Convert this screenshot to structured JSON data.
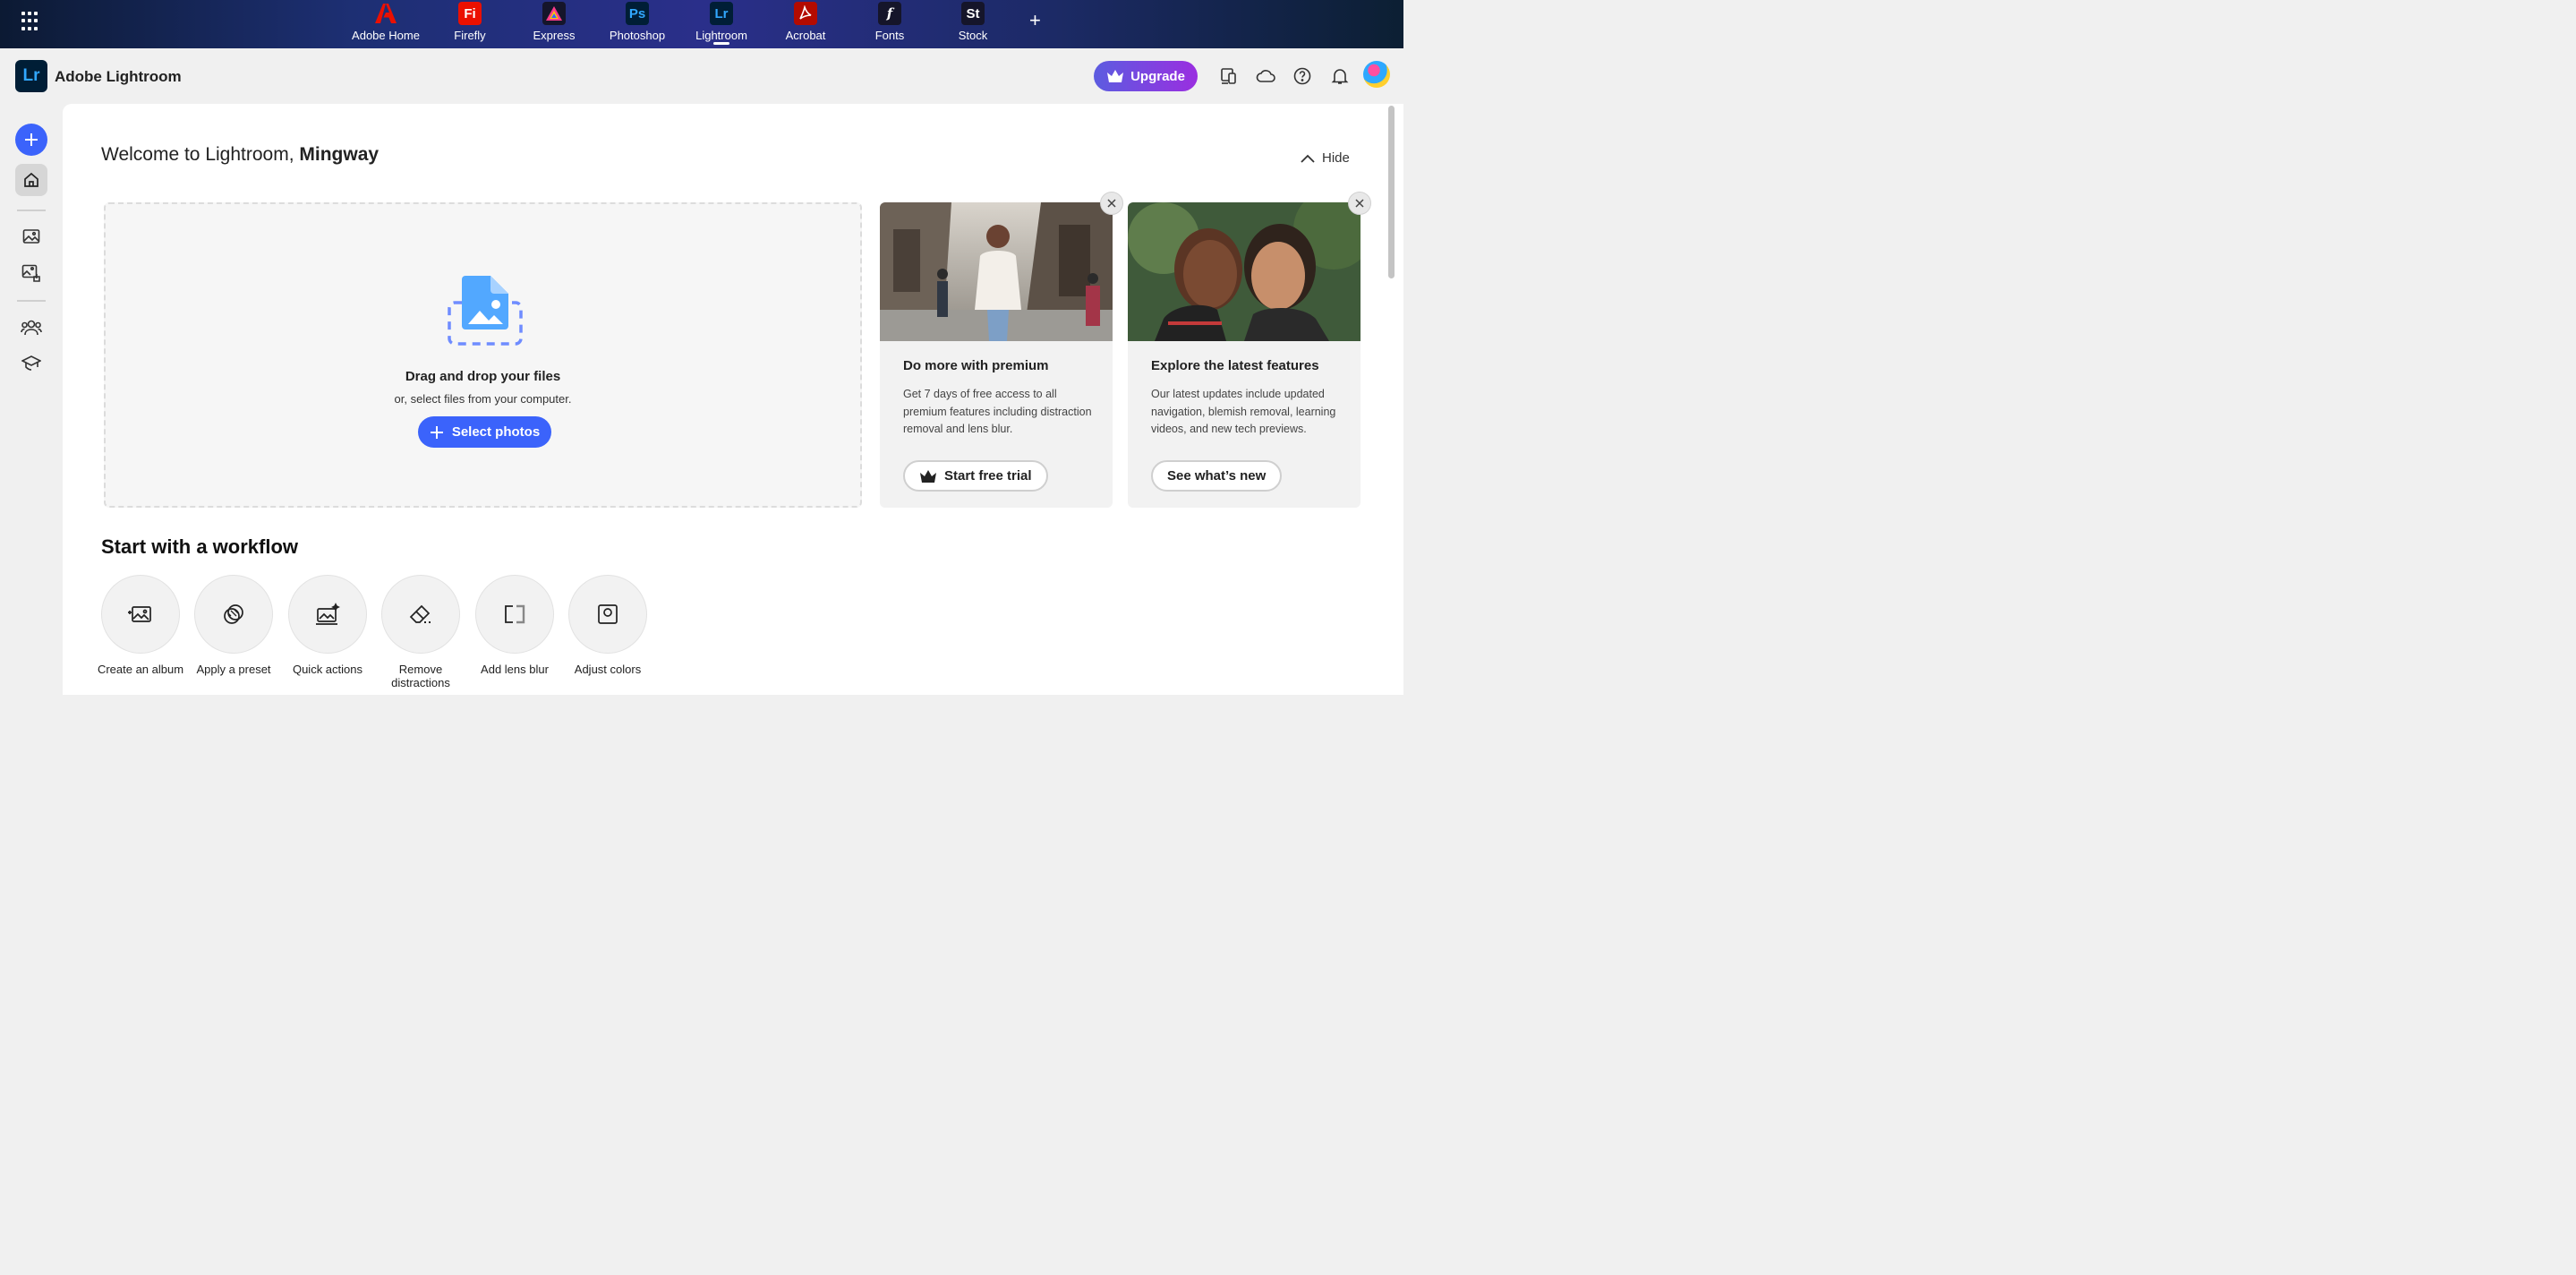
{
  "appbar": {
    "apps": [
      {
        "label": "Adobe Home",
        "glyph": "",
        "color": "#1b1b1b",
        "icon": "adobe-icon"
      },
      {
        "label": "Firefly",
        "glyph": "Fi",
        "color": "#eb1000",
        "icon": "firefly-icon"
      },
      {
        "label": "Express",
        "glyph": "",
        "color": "#111122",
        "icon": "express-icon"
      },
      {
        "label": "Photoshop",
        "glyph": "Ps",
        "color": "#001e36",
        "icon": "photoshop-icon"
      },
      {
        "label": "Lightroom",
        "glyph": "Lr",
        "color": "#001e36",
        "icon": "lightroom-icon"
      },
      {
        "label": "Acrobat",
        "glyph": "",
        "color": "#b30b00",
        "icon": "acrobat-icon"
      },
      {
        "label": "Fonts",
        "glyph": "f",
        "color": "#111122",
        "icon": "fonts-icon"
      },
      {
        "label": "Stock",
        "glyph": "St",
        "color": "#111122",
        "icon": "stock-icon"
      }
    ],
    "active_app": "Lightroom"
  },
  "header": {
    "logo_text": "Lr",
    "title": "Adobe Lightroom",
    "upgrade_label": "Upgrade",
    "accent": "#3b63fb"
  },
  "welcome": {
    "prefix": "Welcome to Lightroom,",
    "name": "Mingway",
    "hide_label": "Hide"
  },
  "dropzone": {
    "title": "Drag and drop your files",
    "subtitle": "or, select files from your computer.",
    "button_label": "Select photos"
  },
  "cards": [
    {
      "title": "Do more with premium",
      "body": "Get 7 days of free access to all premium features including distraction removal and lens blur.",
      "button_label": "Start free trial"
    },
    {
      "title": "Explore the latest features",
      "body": "Our latest updates include updated navigation, blemish removal, learning videos, and new tech previews.",
      "button_label": "See what’s new"
    }
  ],
  "workflow": {
    "title": "Start with a workflow",
    "items": [
      {
        "label": "Create an album",
        "icon": "create-album-icon"
      },
      {
        "label": "Apply a preset",
        "icon": "preset-icon"
      },
      {
        "label": "Quick actions",
        "icon": "quick-actions-icon"
      },
      {
        "label": "Remove distractions",
        "icon": "eraser-icon"
      },
      {
        "label": "Add lens blur",
        "icon": "lens-blur-icon"
      },
      {
        "label": "Adjust colors",
        "icon": "adjust-colors-icon"
      }
    ]
  }
}
